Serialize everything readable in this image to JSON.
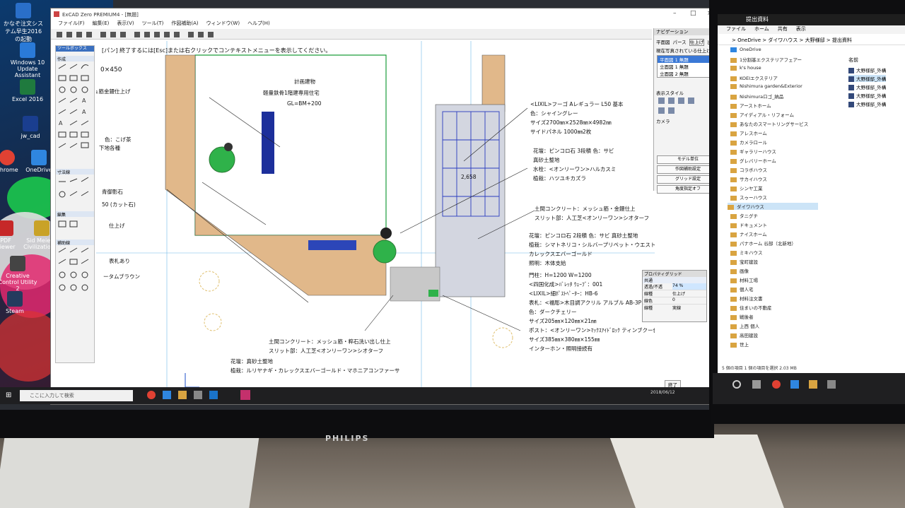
{
  "left_monitor": {
    "brand": "PHILIPS",
    "desktop_icons": [
      {
        "label": "かなぞ注文システム早生2016の起動",
        "color": "#2a6fc9"
      },
      {
        "label": "Windows 10 Update Assistant",
        "color": "#2a7ad8"
      },
      {
        "label": "Excel 2016",
        "color": "#1f7a3e"
      },
      {
        "label": "jw_cad",
        "color": "#1a3e8f"
      },
      {
        "label": "Chrome",
        "color": "#e04133"
      },
      {
        "label": "OneDrive",
        "color": "#2f86e0"
      },
      {
        "label": "PDF Viewer",
        "color": "#c62828"
      },
      {
        "label": "Sid Meier's Civilization V",
        "color": "#c9a227"
      },
      {
        "label": "Creative Control Utility 2",
        "color": "#444"
      },
      {
        "label": "Steam",
        "color": "#243b5e"
      }
    ],
    "window": {
      "title": "ExCAD Zero PREMIUM4 - [無題]",
      "menu": [
        "ファイル(F)",
        "編集(E)",
        "表示(V)",
        "ツール(T)",
        "作図補助(A)",
        "ウィンドウ(W)",
        "ヘルプ(H)"
      ],
      "status_hint": "[パン] 終了するには[Esc]または右クリックでコンテキストメニューを表示してください。",
      "toolbox": {
        "title": "ツールボックス",
        "sections": [
          "作成",
          "寸法線",
          "編集",
          "補助線"
        ]
      },
      "cad_labels": {
        "plan_title": "計画建物",
        "plan_sub": "軽量鉄骨1階建専用住宅",
        "plan_gl": "GL=BM+200",
        "dim_left": "0×450",
        "carport_title": "<LIXIL>フーゴ Aレギュラー L50 基本",
        "carport_color": "色：シャイングレー",
        "carport_size": "サイズ2700㎜×2528㎜×4982㎜",
        "carport_panel": "サイドパネル 1000㎜2枚",
        "bed_1": "花壇：ピンコロ石 3段積 色：サビ",
        "bed_1b": "真砂土整地",
        "water": "水栓：<オンリーワン>ハルカスミ",
        "plant_1": "植栽：ハツユキカズラ",
        "concrete_1": "土間コンクリート：メッシュ筋・金鏝仕上",
        "slit_1": "スリット部：人工芝<オンリーワン>シオターフ",
        "bed_2": "花壇：ピンコロ石 2段積 色：サビ 真砂土整地",
        "plant_2": "植栽：シマトネリコ・シルバープリペット・ウエストリンジア・",
        "plant_2b": "カレックスエバーゴールド",
        "light": "照明：木体支給",
        "gate_pillar": "門柱：H=1200 W=1200",
        "gate_block": "<四国化成>ﾊﾞﾚｯﾀ ｳｪｰﾌﾞ：001",
        "gate_letter": "<LIXIL>細ﾎﾟｽﾄﾍﾟｰﾀｰ：HB-6",
        "nameplate": "表札：<福彫>木目調アクリル アルブル AB-3P",
        "nameplate_color": "色：ダークチェリー",
        "nameplate_size": "サイズ205㎜×120㎜×21㎜",
        "post": "ポスト：<オンリーワン>ﾏｯｸｽｱｲﾄﾞﾛｯｸ ティンブクー色：ステ",
        "post_size": "サイズ385㎜×380㎜×155㎜",
        "intercom": "インターホン・照明接続有",
        "concrete_2": "土間コンクリート：メッシュ筋・粹石洗い出し仕上",
        "slit_2": "スリット部：人工芝<オンリーワン>シオターフ",
        "bed_3": "花壇：真砂土整地",
        "plant_3": "植栽：ルリヤナギ・カレックスエバーゴールド・マホニアコンファーサ",
        "left_1": "ュ筋金鏝仕上げ",
        "left_2": "色：こげ茶",
        "left_3": "下地各種",
        "left_4": "青御影石",
        "left_5": "50 (カット石)",
        "left_6": "表札あり",
        "left_7": "ータムブラウン",
        "left_8": "仕上げ",
        "dim_258": "2,658"
      },
      "nav_panel": {
        "title": "ナビゲーション",
        "tabs": [
          "平面図",
          "パース",
          "仕上げ",
          "出図"
        ],
        "subtitle": "現在写真されている仕上げ",
        "rows": [
          "平面図 1 無題",
          "立面図 1 無題",
          "立面図 2 無題"
        ],
        "style_label": "表示スタイル",
        "camera_label": "カメラ",
        "buttons": [
          "モデル単位",
          "作図補助設定",
          "グリッド設定",
          "角度指定オフ"
        ]
      },
      "prop_panel": {
        "title": "プロパティグリッド",
        "header": "共通",
        "rows": [
          [
            "透過/不透",
            "74 %"
          ],
          [
            "線種",
            "仕上げ"
          ],
          [
            "線色",
            "0"
          ],
          [
            "線種",
            "実線"
          ]
        ],
        "close": "終了"
      }
    },
    "taskbar": {
      "search_placeholder": "ここに入力して検索",
      "clock": "2018/06/12"
    }
  },
  "right_monitor": {
    "window_title": "提出資料",
    "ribbon": [
      "ファイル",
      "ホーム",
      "共有",
      "表示"
    ],
    "address": "> OneDrive > ダイワハウス > 大野様邸 > 提出資料",
    "tree": [
      "OneDrive",
      "1分割基エクステリアフェアー",
      "k's house",
      "KOEIエクステリア",
      "Nishimura garden&Exterior",
      "Nishimuraロゴ_納品",
      "アーストホーム",
      "アイディアル・リフォーム",
      "あなたのスマートリングサービス",
      "アレスホーム",
      "カメラロール",
      "ギャラリーハウス",
      "グレバリーホーム",
      "コラボハウス",
      "サカイハウス",
      "シンヤ工業",
      "スゥーハウス",
      "ダイワハウス",
      "タニグチ",
      "ドキュメント",
      "ナイスホーム",
      "パナホーム 谷部（北新地）",
      "ミキハウス",
      "宝町建設",
      "画像",
      "材料工場",
      "個人宅",
      "材料注文書",
      "住まいの不動産",
      "戦後者",
      "上西 個人",
      "高田建設",
      "世上"
    ],
    "files_header": "名前",
    "files": [
      "大野様邸_外構",
      "大野様邸_外構",
      "大野様邸_外構",
      "大野様邸_外構",
      "大野様邸_外構"
    ],
    "status": "5 個の項目  1 個の項目を選択 2.03 MB"
  }
}
